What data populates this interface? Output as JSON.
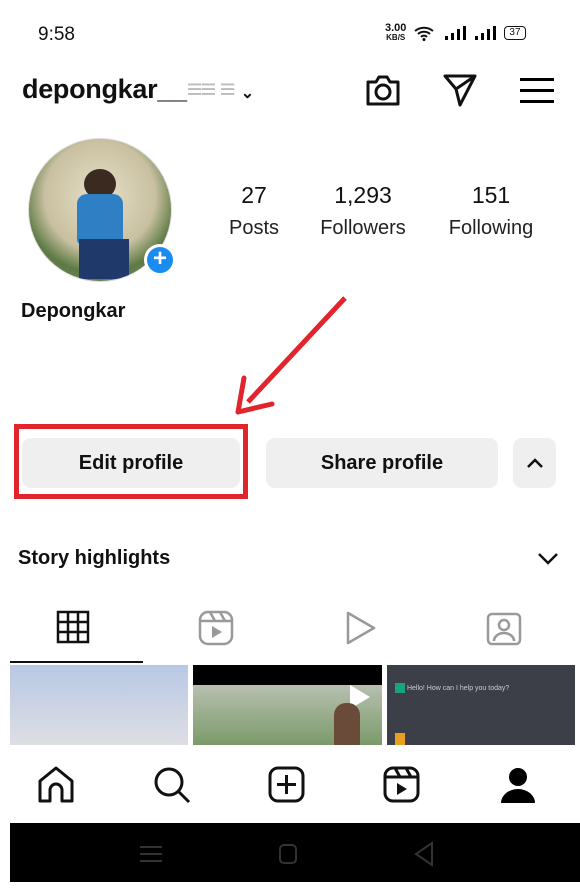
{
  "status_bar": {
    "time": "9:58",
    "net_speed": "3.00",
    "net_unit": "KB/S",
    "battery": "37"
  },
  "header": {
    "username": "depongkar__",
    "icons": [
      "camera-icon",
      "direct-message-icon",
      "menu-icon"
    ]
  },
  "profile": {
    "display_name": "Depongkar",
    "stats": [
      {
        "value": "27",
        "label": "Posts"
      },
      {
        "value": "1,293",
        "label": "Followers"
      },
      {
        "value": "151",
        "label": "Following"
      }
    ]
  },
  "actions": {
    "edit_profile": "Edit profile",
    "share_profile": "Share profile"
  },
  "highlights": {
    "title": "Story highlights"
  },
  "tabs": [
    "grid-icon",
    "reels-icon",
    "video-icon",
    "tagged-icon"
  ],
  "thumbnails": {
    "chat_text": "Hello! How can I help you today?"
  },
  "annotation_color": "#e0262c",
  "bottom_nav": [
    "home-icon",
    "search-icon",
    "create-icon",
    "reels-icon",
    "profile-icon"
  ]
}
